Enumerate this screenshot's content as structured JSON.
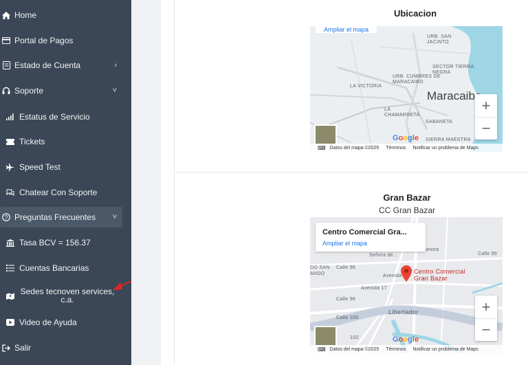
{
  "sidebar": {
    "items": [
      {
        "label": "Home",
        "icon": "home-icon"
      },
      {
        "label": "Portal de Pagos",
        "icon": "credit-card-icon"
      },
      {
        "label": "Estado de Cuenta",
        "icon": "file-icon",
        "chevron": "›"
      },
      {
        "label": "Soporte",
        "icon": "headset-icon",
        "chevron": "˅"
      },
      {
        "label": "Estatus de Servicio",
        "icon": "signal-icon"
      },
      {
        "label": "Tickets",
        "icon": "ticket-icon"
      },
      {
        "label": "Speed Test",
        "icon": "plane-icon"
      },
      {
        "label": "Chatear Con Soporte",
        "icon": "chat-icon"
      },
      {
        "label": "Preguntas Frecuentes",
        "icon": "question-icon",
        "chevron": "˅"
      },
      {
        "label": "Tasa BCV = 156.37",
        "icon": "bank-icon"
      },
      {
        "label": "Cuentas Bancarias",
        "icon": "list-icon"
      },
      {
        "label": "Sedes tecnoven services, c.a.",
        "icon": "map-icon"
      },
      {
        "label": "Video de Ayuda",
        "icon": "video-icon"
      },
      {
        "label": "Salir",
        "icon": "logout-icon"
      }
    ]
  },
  "cards": [
    {
      "title": "Ubicacion",
      "map": {
        "link": "Ampliar el mapa",
        "labels": [
          "URB. SAN JACINTO",
          "SECTOR TIERRA NEGRA",
          "URB. CUMBRES DE MARACAIBO",
          "LA VICTORIA",
          "LA CHAMARRETA",
          "SABANETA",
          "SIERRA MAESTRA"
        ],
        "city": "Maracaibo",
        "attribution": {
          "data": "Datos del mapa ©2025",
          "terms": "Términos",
          "report": "Notificar un problema de Maps"
        },
        "google": "Google",
        "zoom_in": "+",
        "zoom_out": "−"
      }
    },
    {
      "title": "Gran Bazar",
      "subtitle": "CC Gran Bazar",
      "map": {
        "place_name": "Centro Comercial Gra...",
        "link": "Ampliar el mapa",
        "labels": [
          "DO SAN",
          "ANDO",
          "Calle 96",
          "Calle 98",
          "Calle 100",
          "Avenida 17",
          "Avenida 16",
          "Libertador",
          "Basílica Santuario de Nuestra Señora de...",
          "Calle 95",
          "102"
        ],
        "pin_label": "Centro Comercial Gran Bazar",
        "attribution": {
          "data": "Datos del mapa ©2025",
          "terms": "Términos",
          "report": "Notificar un problema de Maps"
        },
        "google": "Google",
        "zoom_in": "+",
        "zoom_out": "−"
      }
    }
  ],
  "colors": {
    "sidebar": "#3b4756",
    "sidebar_active": "#4a5868",
    "arrow": "#e02424",
    "link": "#1a73e8",
    "pin": "#ea4335"
  }
}
